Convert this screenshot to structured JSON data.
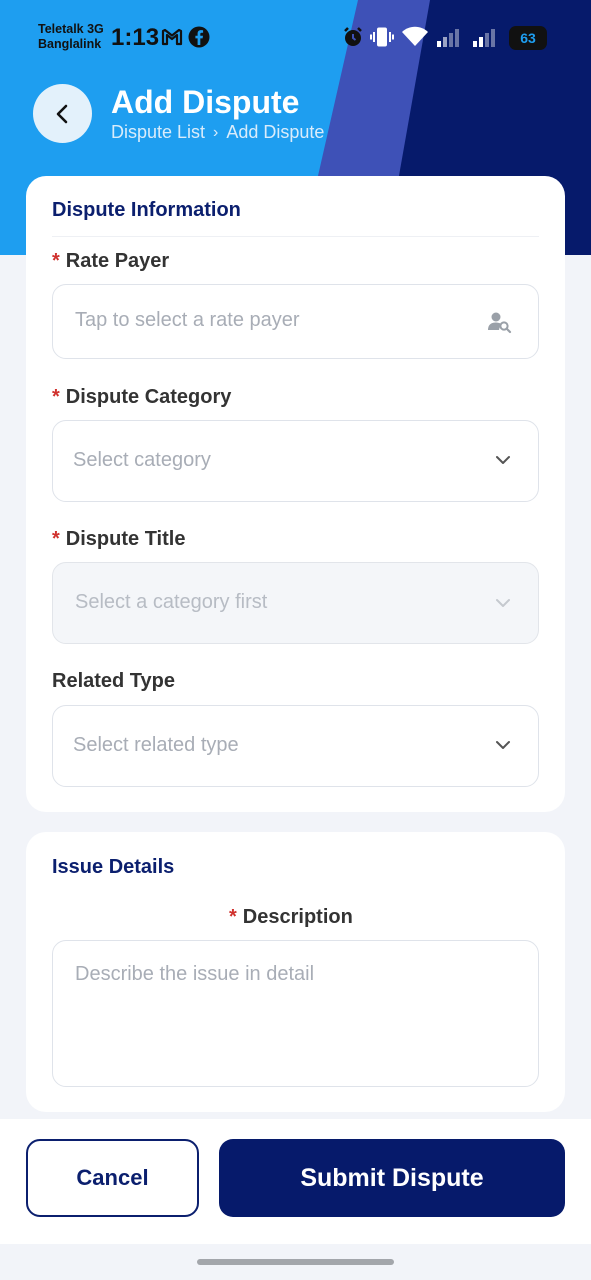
{
  "status_bar": {
    "carrier_1": "Teletalk 3G",
    "carrier_2": "Banglalink",
    "time": "1:13",
    "battery": "63"
  },
  "header": {
    "title": "Add Dispute",
    "breadcrumb": [
      "Dispute List",
      "Add Dispute"
    ],
    "breadcrumb_separator": "›"
  },
  "dispute_information": {
    "section_title": "Dispute Information",
    "rate_payer": {
      "required_mark": "*",
      "label": "Rate Payer",
      "placeholder": "Tap to select a rate payer"
    },
    "dispute_category": {
      "required_mark": "*",
      "label": "Dispute Category",
      "placeholder": "Select category"
    },
    "dispute_title": {
      "required_mark": "*",
      "label": "Dispute Title",
      "placeholder": "Select a category first",
      "disabled": true
    },
    "related_type": {
      "label": "Related Type",
      "placeholder": "Select related type"
    }
  },
  "issue_details": {
    "section_title": "Issue Details",
    "description": {
      "required_mark": "*",
      "label": "Description",
      "placeholder": "Describe the issue in detail"
    }
  },
  "actions": {
    "cancel_label": "Cancel",
    "submit_label": "Submit Dispute"
  },
  "colors": {
    "primary": "#061a6b",
    "header_blue": "#1e9ef0",
    "header_mid": "#3e51b7",
    "required": "#d0312d"
  },
  "icons": [
    "back-arrow-icon",
    "user-search-icon",
    "chevron-down-icon",
    "gmail-icon",
    "facebook-icon",
    "alarm-icon",
    "vibrate-icon",
    "wifi-icon",
    "signal-icon"
  ]
}
